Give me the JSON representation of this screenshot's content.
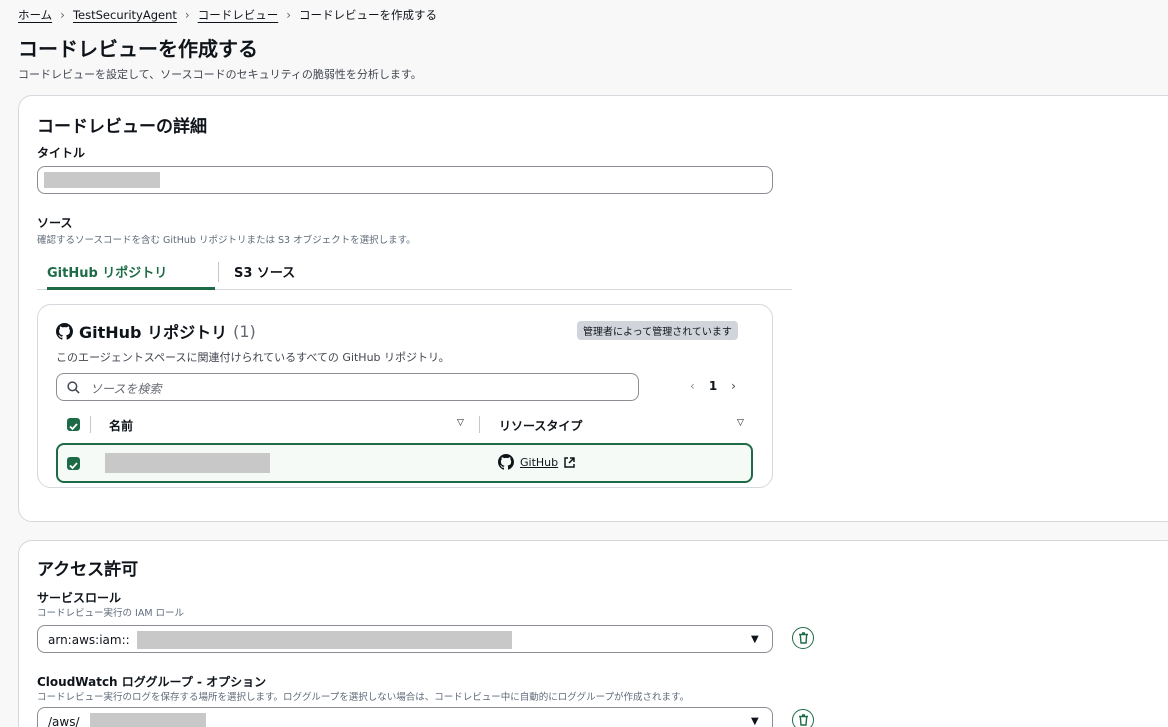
{
  "breadcrumb": {
    "items": [
      "ホーム",
      "TestSecurityAgent",
      "コードレビュー"
    ],
    "current": "コードレビューを作成する"
  },
  "page": {
    "title": "コードレビューを作成する",
    "description": "コードレビューを設定して、ソースコードのセキュリティの脆弱性を分析します。"
  },
  "details": {
    "title": "コードレビューの詳細",
    "title_label": "タイトル",
    "source_label": "ソース",
    "source_desc": "確認するソースコードを含む GitHub リポジトリまたは S3 オブジェクトを選択します。",
    "tabs": [
      {
        "label": "GitHub リポジトリ",
        "active": true
      },
      {
        "label": "S3 ソース",
        "active": false
      }
    ]
  },
  "repo_table": {
    "title": "GitHub リポジトリ",
    "count": "(1)",
    "badge": "管理者によって管理されています",
    "description": "このエージェントスペースに関連付けられているすべての GitHub リポジトリ。",
    "search_placeholder": "ソースを検索",
    "page": "1",
    "columns": [
      "名前",
      "リソースタイプ"
    ],
    "row": {
      "type": "GitHub"
    }
  },
  "access": {
    "title": "アクセス許可",
    "role_label": "サービスロール",
    "role_desc": "コードレビュー実行の IAM ロール",
    "role_value": "arn:aws:iam::",
    "log_label": "CloudWatch ロググループ - オプション",
    "log_desc": "コードレビュー実行のログを保存する場所を選択します。ロググループを選択しない場合は、コードレビュー中に自動的にロググループが作成されます。",
    "log_value": "/aws/"
  },
  "colors": {
    "accent": "#1d6b46"
  }
}
